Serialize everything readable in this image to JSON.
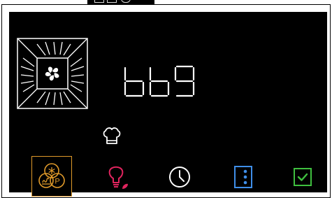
{
  "display": {
    "reading": "bb9",
    "segment_color": "#ffffff"
  },
  "icons": {
    "oven": "oven-fan-icon",
    "chef": "chef-hat-icon",
    "mode": "fan-steam-program-icon",
    "light": "oven-light-icon",
    "timer": "clock-icon",
    "options": "vertical-dots-icon",
    "confirm": "checkmark-icon"
  },
  "colors": {
    "mode": "#e09a2a",
    "light": "#e0245e",
    "light_leaf": "#e0245e",
    "timer": "#ffffff",
    "options": "#3f8ee8",
    "confirm": "#3fbf3f",
    "screen": "#000000"
  },
  "mode_button": {
    "program_letter": "P"
  }
}
